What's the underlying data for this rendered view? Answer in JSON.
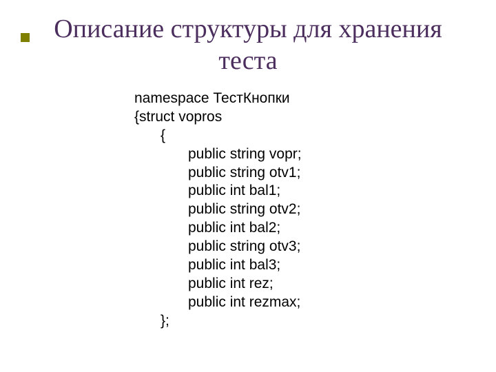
{
  "title_line1": "Описание структуры для хранения",
  "title_line2": "теста",
  "code": {
    "l0": "namespace ТестКнопки",
    "l1": "{struct vopros",
    "l2": "{",
    "l3": "public string vopr;",
    "l4": "public string otv1;",
    "l5": "public int bal1;",
    "l6": "public string otv2;",
    "l7": "public int bal2;",
    "l8": "public string otv3;",
    "l9": "public int bal3;",
    "l10": "public int rez;",
    "l11": "public int rezmax;",
    "l12": "};"
  }
}
